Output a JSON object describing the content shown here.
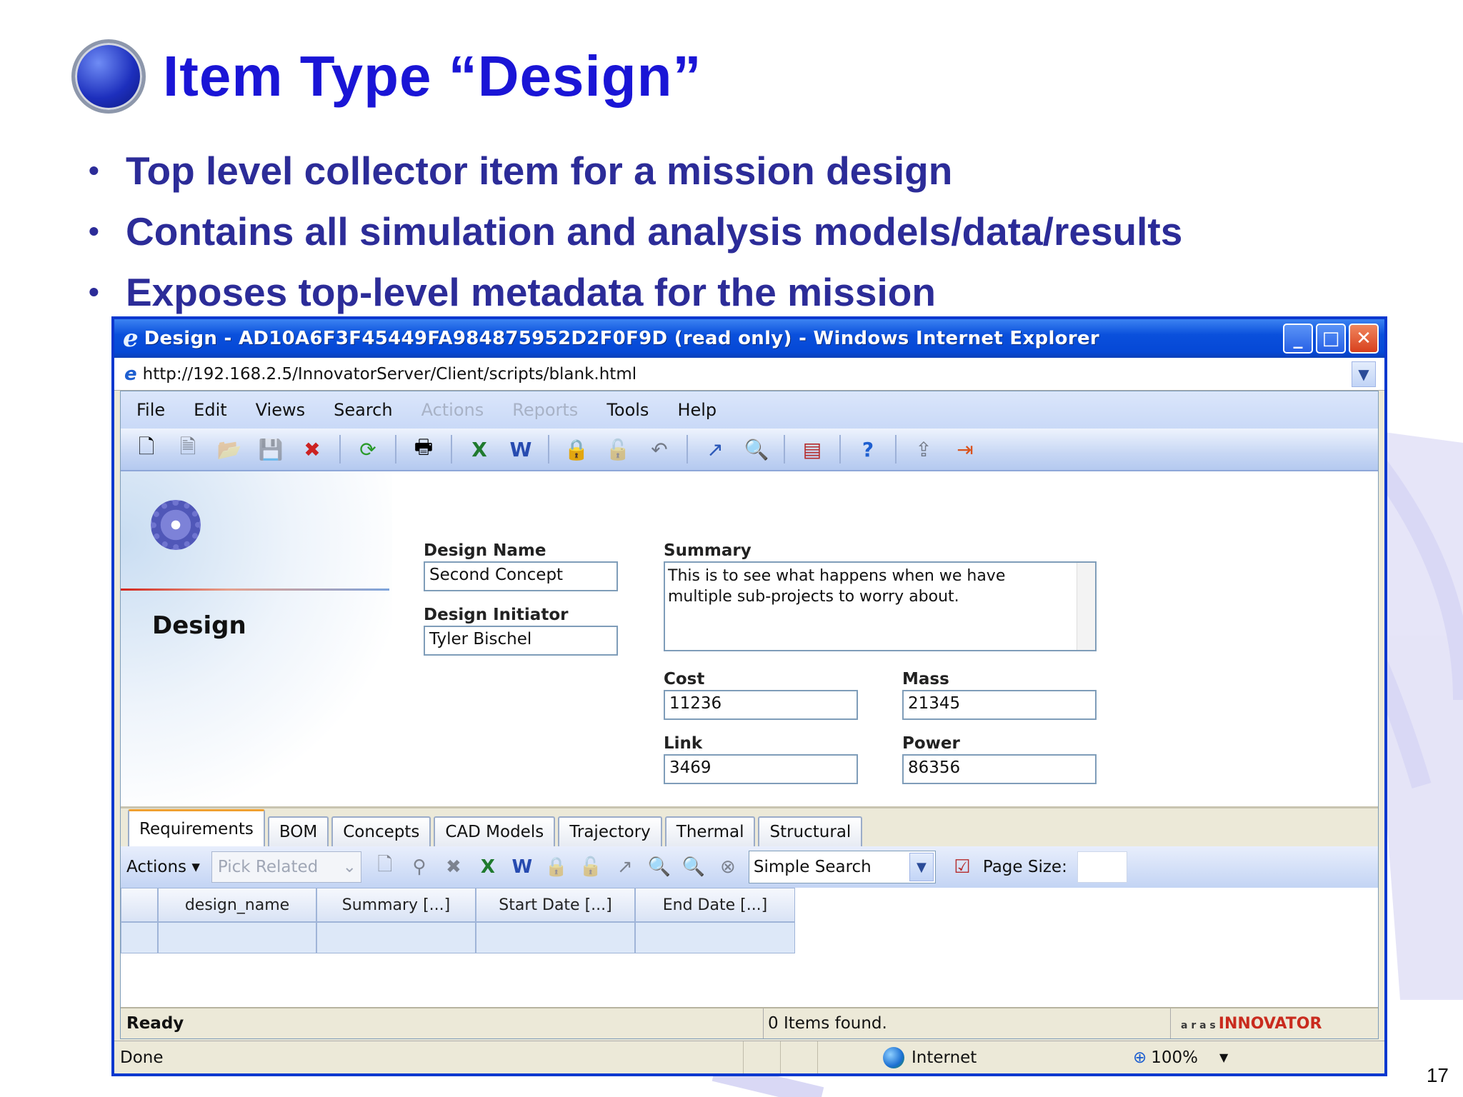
{
  "slide": {
    "title": "Item Type “Design”",
    "bullets": [
      "Top level collector item for a mission design",
      "Contains all simulation and analysis models/data/results",
      "Exposes top-level metadata for the mission"
    ],
    "page_number": "17"
  },
  "browser": {
    "window_title": "Design - AD10A6F3F45449FA984875952D2F0F9D (read only) - Windows Internet Explorer",
    "address": "http://192.168.2.5/InnovatorServer/Client/scripts/blank.html",
    "status_done": "Done",
    "zone": "Internet",
    "zoom": "100%"
  },
  "menu": {
    "items": [
      {
        "label": "File",
        "enabled": true
      },
      {
        "label": "Edit",
        "enabled": true
      },
      {
        "label": "Views",
        "enabled": true
      },
      {
        "label": "Search",
        "enabled": true
      },
      {
        "label": "Actions",
        "enabled": false
      },
      {
        "label": "Reports",
        "enabled": false
      },
      {
        "label": "Tools",
        "enabled": true
      },
      {
        "label": "Help",
        "enabled": true
      }
    ]
  },
  "toolbar": {
    "icons": [
      "new-icon",
      "view-icon",
      "open-icon",
      "save-icon",
      "delete-icon",
      "refresh-icon",
      "print-icon",
      "excel-icon",
      "word-icon",
      "lock-icon",
      "unlock-icon",
      "undo-icon",
      "promote-icon",
      "where-used-icon",
      "structure-browser-icon",
      "help-icon",
      "disabled-export-icon",
      "exit-icon"
    ]
  },
  "form": {
    "heading": "Design",
    "design_name_label": "Design Name",
    "design_name": "Second Concept",
    "initiator_label": "Design Initiator",
    "initiator": "Tyler Bischel",
    "summary_label": "Summary",
    "summary": "This is to see what happens when we have multiple sub-projects to worry about.",
    "cost_label": "Cost",
    "cost": "11236",
    "mass_label": "Mass",
    "mass": "21345",
    "link_label": "Link",
    "link": "3469",
    "power_label": "Power",
    "power": "86356"
  },
  "relationships": {
    "tabs": [
      "Requirements",
      "BOM",
      "Concepts",
      "CAD Models",
      "Trajectory",
      "Thermal",
      "Structural"
    ],
    "active_tab": "Requirements",
    "actions_label": "Actions ▾",
    "pick_related": "Pick Related",
    "search_mode": "Simple Search",
    "page_size_label": "Page Size:",
    "columns": [
      "design_name",
      "Summary [...]",
      "Start Date [...]",
      "End Date [...]"
    ]
  },
  "status": {
    "ready": "Ready",
    "items_found": "0 Items found.",
    "brand_top": "a r a s",
    "brand_bottom": "INNOVATOR"
  },
  "colors": {
    "title_blue": "#1a15d6",
    "bullet_text": "#2c2c98",
    "xp_titlebar": "#0a50dc"
  }
}
